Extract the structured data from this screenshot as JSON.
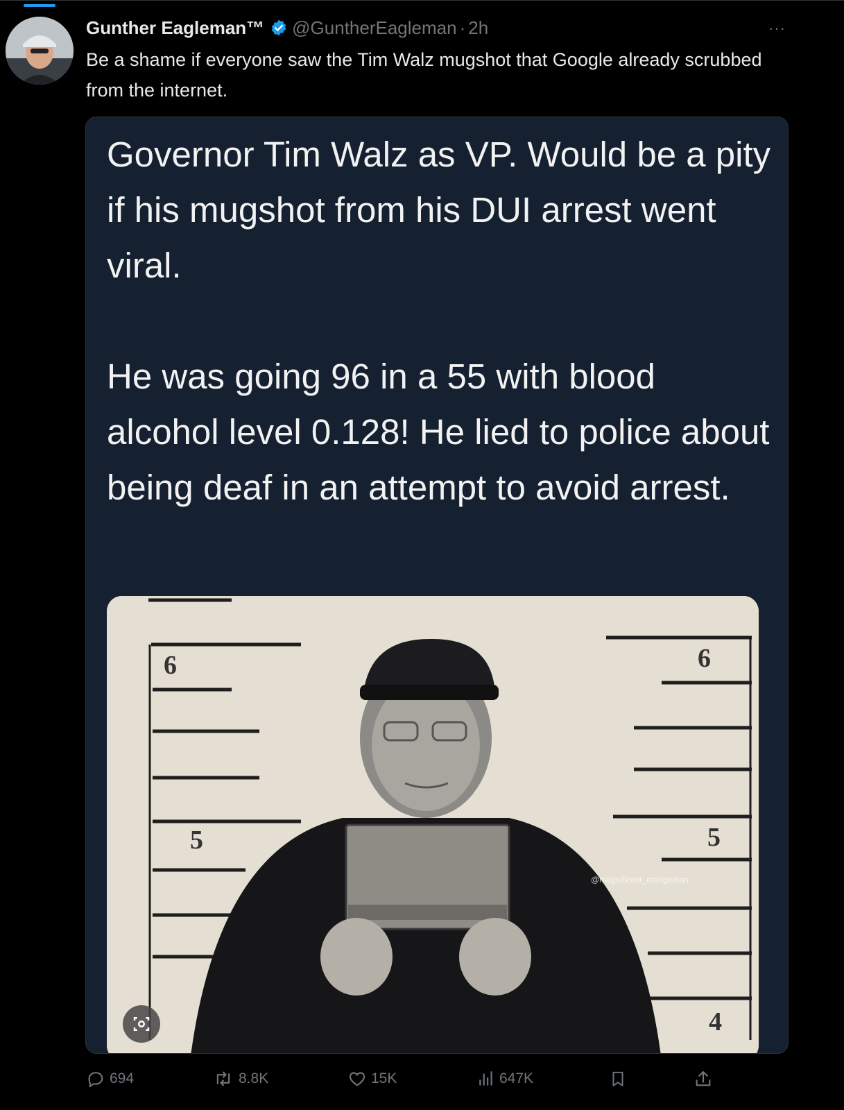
{
  "tweet": {
    "author_name": "Gunther Eagleman™",
    "author_handle": "@GuntherEagleman",
    "separator": "·",
    "time_ago": "2h",
    "more_label": "···",
    "text": "Be a shame if everyone saw the Tim Walz mugshot that Google already scrubbed from the internet."
  },
  "media": {
    "paragraph_1": "Governor Tim Walz as VP. Would be a pity if his mugshot from his DUI arrest went viral.",
    "paragraph_2": "He was going 96 in a 55 with blood alcohol level 0.128! He lied to police about being deaf in an attempt to avoid arrest.",
    "ruler_left_6": "6",
    "ruler_left_5": "5",
    "ruler_right_6": "6",
    "ruler_right_5": "5",
    "ruler_right_4": "4",
    "watermark": "@magnificent_orangeman"
  },
  "actions": {
    "replies": "694",
    "reposts": "8.8K",
    "likes": "15K",
    "views": "647K"
  },
  "colors": {
    "background": "#000000",
    "accent": "#1d9bf0",
    "muted": "#71767b",
    "media_bg": "#152030"
  },
  "icons": [
    "verified-badge-icon",
    "more-icon",
    "reply-icon",
    "repost-icon",
    "like-icon",
    "views-icon",
    "bookmark-icon",
    "share-icon",
    "alt-media-icon"
  ]
}
